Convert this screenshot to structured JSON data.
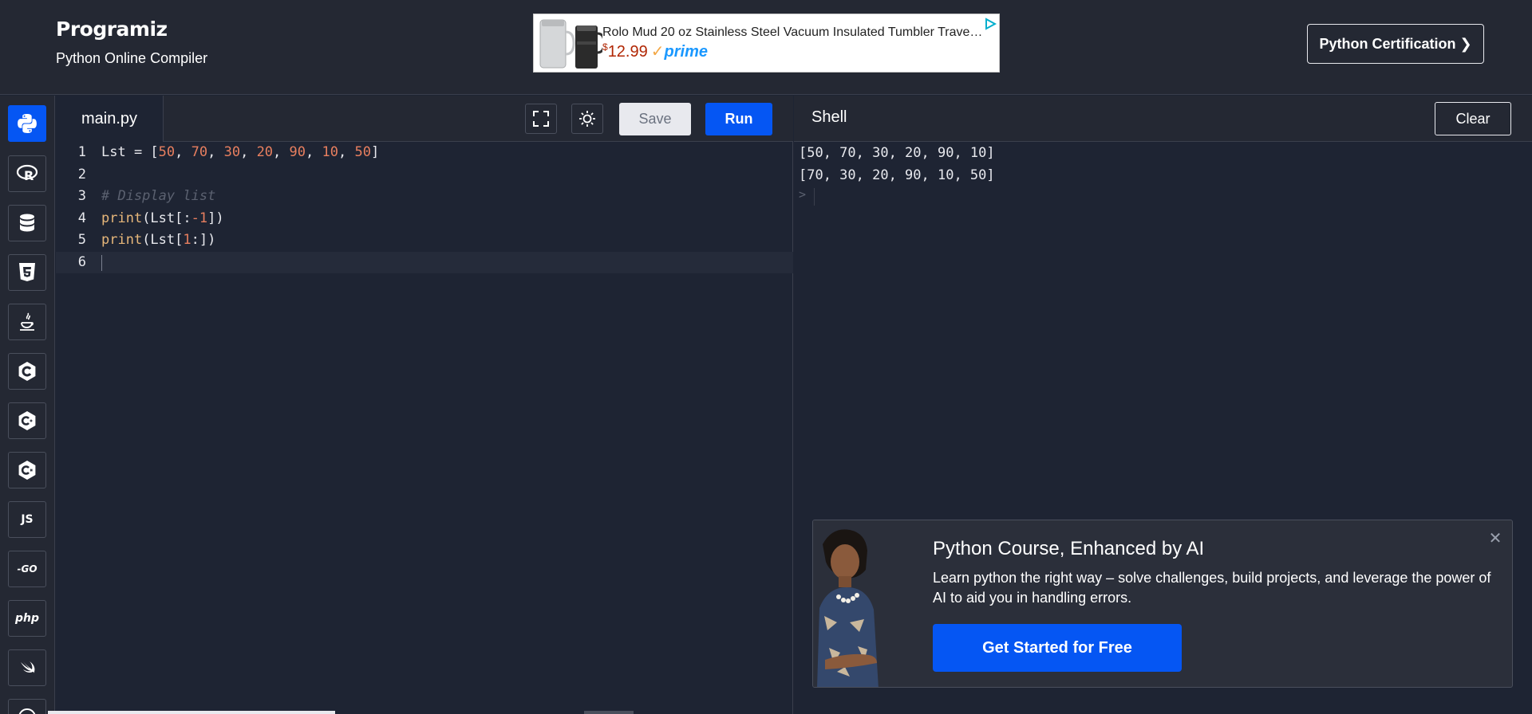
{
  "header": {
    "logo": "Programiz",
    "subtitle": "Python Online Compiler",
    "cert_button": "Python Certification ❯",
    "ad": {
      "title": "Rolo Mud 20 oz Stainless Steel Vacuum Insulated Tumbler Trave…",
      "price_symbol": "$",
      "price": "12.99",
      "check": "✓",
      "prime": "prime"
    }
  },
  "sidebar": {
    "items": [
      {
        "name": "python",
        "icon": "python-icon",
        "active": true
      },
      {
        "name": "r",
        "icon": "r-icon"
      },
      {
        "name": "sql",
        "icon": "database-icon"
      },
      {
        "name": "html",
        "icon": "html5-icon"
      },
      {
        "name": "java",
        "icon": "java-icon"
      },
      {
        "name": "c",
        "icon": "c-icon"
      },
      {
        "name": "cpp",
        "icon": "cpp-icon"
      },
      {
        "name": "csharp",
        "icon": "csharp-icon"
      },
      {
        "name": "javascript",
        "label": "JS"
      },
      {
        "name": "go",
        "label": "-GO"
      },
      {
        "name": "php",
        "label": "php"
      },
      {
        "name": "swift",
        "icon": "swift-icon"
      }
    ]
  },
  "editor": {
    "file_tab": "main.py",
    "save_label": "Save",
    "run_label": "Run",
    "lines": [
      {
        "n": "1",
        "tokens": [
          [
            "Lst = [",
            ""
          ],
          [
            "50",
            "num"
          ],
          [
            ", ",
            ""
          ],
          [
            "70",
            "num"
          ],
          [
            ", ",
            ""
          ],
          [
            "30",
            "num"
          ],
          [
            ", ",
            ""
          ],
          [
            "20",
            "num"
          ],
          [
            ", ",
            ""
          ],
          [
            "90",
            "num"
          ],
          [
            ", ",
            ""
          ],
          [
            "10",
            "num"
          ],
          [
            ", ",
            ""
          ],
          [
            "50",
            "num"
          ],
          [
            "]",
            ""
          ]
        ]
      },
      {
        "n": "2",
        "tokens": []
      },
      {
        "n": "3",
        "tokens": [
          [
            "# Display list",
            "cm"
          ]
        ]
      },
      {
        "n": "4",
        "tokens": [
          [
            "print",
            "kw"
          ],
          [
            "(Lst[:",
            ""
          ],
          [
            "-1",
            "num"
          ],
          [
            "])",
            ""
          ]
        ]
      },
      {
        "n": "5",
        "tokens": [
          [
            "print",
            "kw"
          ],
          [
            "(Lst[",
            ""
          ],
          [
            "1",
            "num"
          ],
          [
            ":])",
            ""
          ]
        ]
      },
      {
        "n": "6",
        "tokens": [],
        "current": true
      }
    ]
  },
  "shell": {
    "title": "Shell",
    "clear_label": "Clear",
    "output": [
      "[50, 70, 30, 20, 90, 10]",
      "[70, 30, 20, 90, 10, 50]"
    ],
    "prompt": ">"
  },
  "promo": {
    "title": "Python Course, Enhanced by AI",
    "text": "Learn python the right way – solve challenges, build projects, and leverage the power of AI to aid you in handling errors.",
    "cta": "Get Started for Free",
    "close": "✕"
  },
  "colors": {
    "accent": "#0556f3",
    "bg": "#1e2433",
    "panel": "#242833",
    "number": "#e87f5f",
    "keyword": "#e7b77a",
    "comment": "#5b6170"
  }
}
